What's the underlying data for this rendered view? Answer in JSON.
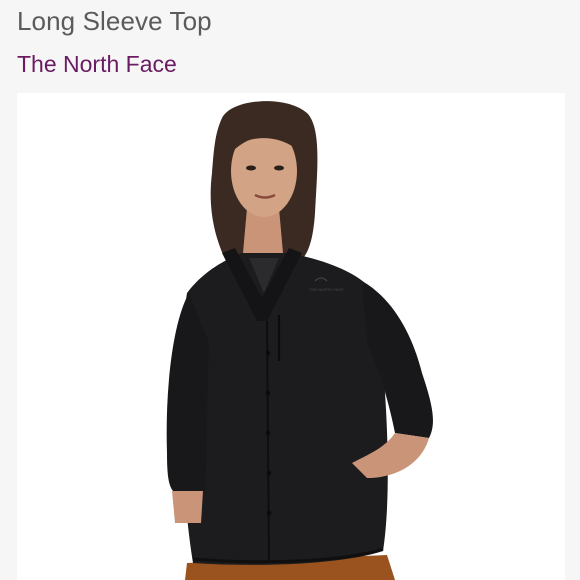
{
  "listing": {
    "title": "Long Sleeve Top",
    "brand": "The North Face"
  },
  "image": {
    "subject": "product-photo",
    "logo_text": "THE NORTH FACE"
  },
  "colors": {
    "title_text": "#5b5b5b",
    "brand_link": "#6a1b61",
    "background": "#f7f6f7",
    "photo_background": "#ffffff",
    "garment": "#1c1c1e",
    "pants": "#9a531f"
  }
}
